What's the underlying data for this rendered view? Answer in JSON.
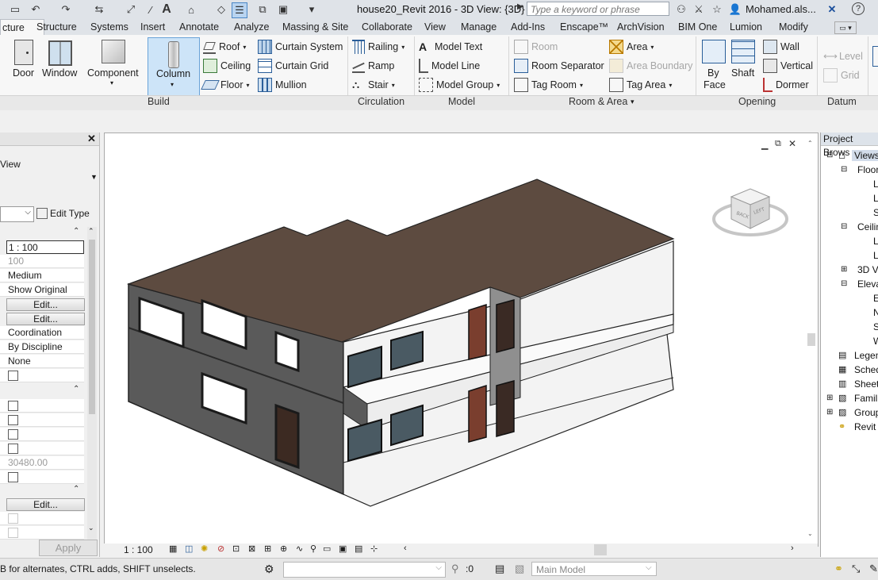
{
  "titlebar": {
    "title": "house20_Revit 2016 - 3D View: {3D}",
    "search_placeholder": "Type a keyword or phrase",
    "user": "Mohamed.als..."
  },
  "tabs": [
    "cture",
    "Structure",
    "Systems",
    "Insert",
    "Annotate",
    "Analyze",
    "Massing & Site",
    "Collaborate",
    "View",
    "Manage",
    "Add-Ins",
    "Enscape™",
    "ArchVision",
    "BIM One",
    "Lumion",
    "Modify"
  ],
  "ribbon": {
    "build": {
      "door": "Door",
      "window": "Window",
      "component": "Component",
      "column": "Column",
      "roof": "Roof",
      "ceiling": "Ceiling",
      "floor": "Floor",
      "curtain_system": "Curtain System",
      "curtain_grid": "Curtain Grid",
      "mullion": "Mullion",
      "label": "Build"
    },
    "circulation": {
      "railing": "Railing",
      "ramp": "Ramp",
      "stair": "Stair",
      "label": "Circulation"
    },
    "model": {
      "text": "Model Text",
      "line": "Model Line",
      "group": "Model Group",
      "label": "Model"
    },
    "room_area": {
      "room": "Room",
      "separator": "Room Separator",
      "tag_room": "Tag Room",
      "area": "Area",
      "area_boundary": "Area Boundary",
      "tag_area": "Tag Area",
      "label": "Room & Area"
    },
    "opening": {
      "by_face_1": "By",
      "by_face_2": "Face",
      "shaft": "Shaft",
      "wall": "Wall",
      "vertical": "Vertical",
      "dormer": "Dormer",
      "label": "Opening"
    },
    "datum": {
      "level": "Level",
      "grid": "Grid",
      "label": "Datum"
    }
  },
  "properties": {
    "type_name": "View",
    "edit_type": "Edit Type",
    "rows": {
      "scale": "1 : 100",
      "scale_value": "100",
      "detail_level": "Medium",
      "parts_visibility": "Show Original",
      "edit": "Edit...",
      "discipline": "Coordination",
      "color_scheme": "By Discipline",
      "default_analysis": "None",
      "far_clip": "30480.00"
    },
    "apply": "Apply"
  },
  "browser": {
    "title": "Project Brows",
    "items": [
      "Views",
      "Floor",
      "L",
      "L",
      "S",
      "Ceilin",
      "L",
      "L",
      "3D V",
      "Eleva",
      "E",
      "N",
      "S",
      "W",
      "Legen",
      "Sched",
      "Sheet",
      "Famili",
      "Group",
      "Revit"
    ]
  },
  "viewbar": {
    "scale": "1 : 100"
  },
  "status": {
    "hint": "B for alternates, CTRL adds, SHIFT unselects.",
    "selection_count": ":0",
    "model": "Main Model"
  }
}
